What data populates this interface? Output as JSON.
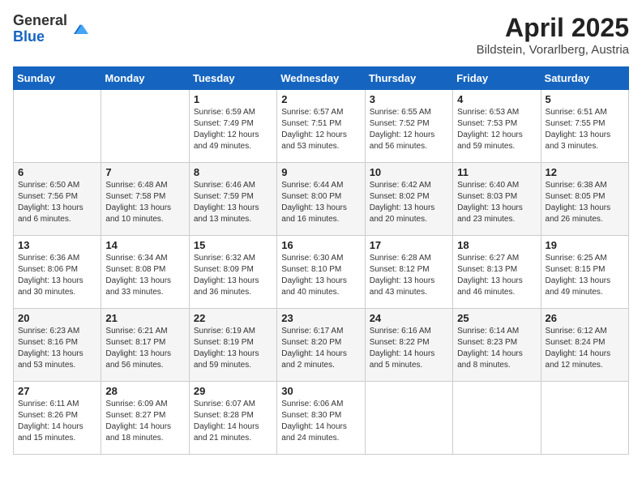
{
  "header": {
    "logo_general": "General",
    "logo_blue": "Blue",
    "title": "April 2025",
    "subtitle": "Bildstein, Vorarlberg, Austria"
  },
  "days_of_week": [
    "Sunday",
    "Monday",
    "Tuesday",
    "Wednesday",
    "Thursday",
    "Friday",
    "Saturday"
  ],
  "weeks": [
    [
      {
        "day": "",
        "detail": ""
      },
      {
        "day": "",
        "detail": ""
      },
      {
        "day": "1",
        "detail": "Sunrise: 6:59 AM\nSunset: 7:49 PM\nDaylight: 12 hours and 49 minutes."
      },
      {
        "day": "2",
        "detail": "Sunrise: 6:57 AM\nSunset: 7:51 PM\nDaylight: 12 hours and 53 minutes."
      },
      {
        "day": "3",
        "detail": "Sunrise: 6:55 AM\nSunset: 7:52 PM\nDaylight: 12 hours and 56 minutes."
      },
      {
        "day": "4",
        "detail": "Sunrise: 6:53 AM\nSunset: 7:53 PM\nDaylight: 12 hours and 59 minutes."
      },
      {
        "day": "5",
        "detail": "Sunrise: 6:51 AM\nSunset: 7:55 PM\nDaylight: 13 hours and 3 minutes."
      }
    ],
    [
      {
        "day": "6",
        "detail": "Sunrise: 6:50 AM\nSunset: 7:56 PM\nDaylight: 13 hours and 6 minutes."
      },
      {
        "day": "7",
        "detail": "Sunrise: 6:48 AM\nSunset: 7:58 PM\nDaylight: 13 hours and 10 minutes."
      },
      {
        "day": "8",
        "detail": "Sunrise: 6:46 AM\nSunset: 7:59 PM\nDaylight: 13 hours and 13 minutes."
      },
      {
        "day": "9",
        "detail": "Sunrise: 6:44 AM\nSunset: 8:00 PM\nDaylight: 13 hours and 16 minutes."
      },
      {
        "day": "10",
        "detail": "Sunrise: 6:42 AM\nSunset: 8:02 PM\nDaylight: 13 hours and 20 minutes."
      },
      {
        "day": "11",
        "detail": "Sunrise: 6:40 AM\nSunset: 8:03 PM\nDaylight: 13 hours and 23 minutes."
      },
      {
        "day": "12",
        "detail": "Sunrise: 6:38 AM\nSunset: 8:05 PM\nDaylight: 13 hours and 26 minutes."
      }
    ],
    [
      {
        "day": "13",
        "detail": "Sunrise: 6:36 AM\nSunset: 8:06 PM\nDaylight: 13 hours and 30 minutes."
      },
      {
        "day": "14",
        "detail": "Sunrise: 6:34 AM\nSunset: 8:08 PM\nDaylight: 13 hours and 33 minutes."
      },
      {
        "day": "15",
        "detail": "Sunrise: 6:32 AM\nSunset: 8:09 PM\nDaylight: 13 hours and 36 minutes."
      },
      {
        "day": "16",
        "detail": "Sunrise: 6:30 AM\nSunset: 8:10 PM\nDaylight: 13 hours and 40 minutes."
      },
      {
        "day": "17",
        "detail": "Sunrise: 6:28 AM\nSunset: 8:12 PM\nDaylight: 13 hours and 43 minutes."
      },
      {
        "day": "18",
        "detail": "Sunrise: 6:27 AM\nSunset: 8:13 PM\nDaylight: 13 hours and 46 minutes."
      },
      {
        "day": "19",
        "detail": "Sunrise: 6:25 AM\nSunset: 8:15 PM\nDaylight: 13 hours and 49 minutes."
      }
    ],
    [
      {
        "day": "20",
        "detail": "Sunrise: 6:23 AM\nSunset: 8:16 PM\nDaylight: 13 hours and 53 minutes."
      },
      {
        "day": "21",
        "detail": "Sunrise: 6:21 AM\nSunset: 8:17 PM\nDaylight: 13 hours and 56 minutes."
      },
      {
        "day": "22",
        "detail": "Sunrise: 6:19 AM\nSunset: 8:19 PM\nDaylight: 13 hours and 59 minutes."
      },
      {
        "day": "23",
        "detail": "Sunrise: 6:17 AM\nSunset: 8:20 PM\nDaylight: 14 hours and 2 minutes."
      },
      {
        "day": "24",
        "detail": "Sunrise: 6:16 AM\nSunset: 8:22 PM\nDaylight: 14 hours and 5 minutes."
      },
      {
        "day": "25",
        "detail": "Sunrise: 6:14 AM\nSunset: 8:23 PM\nDaylight: 14 hours and 8 minutes."
      },
      {
        "day": "26",
        "detail": "Sunrise: 6:12 AM\nSunset: 8:24 PM\nDaylight: 14 hours and 12 minutes."
      }
    ],
    [
      {
        "day": "27",
        "detail": "Sunrise: 6:11 AM\nSunset: 8:26 PM\nDaylight: 14 hours and 15 minutes."
      },
      {
        "day": "28",
        "detail": "Sunrise: 6:09 AM\nSunset: 8:27 PM\nDaylight: 14 hours and 18 minutes."
      },
      {
        "day": "29",
        "detail": "Sunrise: 6:07 AM\nSunset: 8:28 PM\nDaylight: 14 hours and 21 minutes."
      },
      {
        "day": "30",
        "detail": "Sunrise: 6:06 AM\nSunset: 8:30 PM\nDaylight: 14 hours and 24 minutes."
      },
      {
        "day": "",
        "detail": ""
      },
      {
        "day": "",
        "detail": ""
      },
      {
        "day": "",
        "detail": ""
      }
    ]
  ]
}
